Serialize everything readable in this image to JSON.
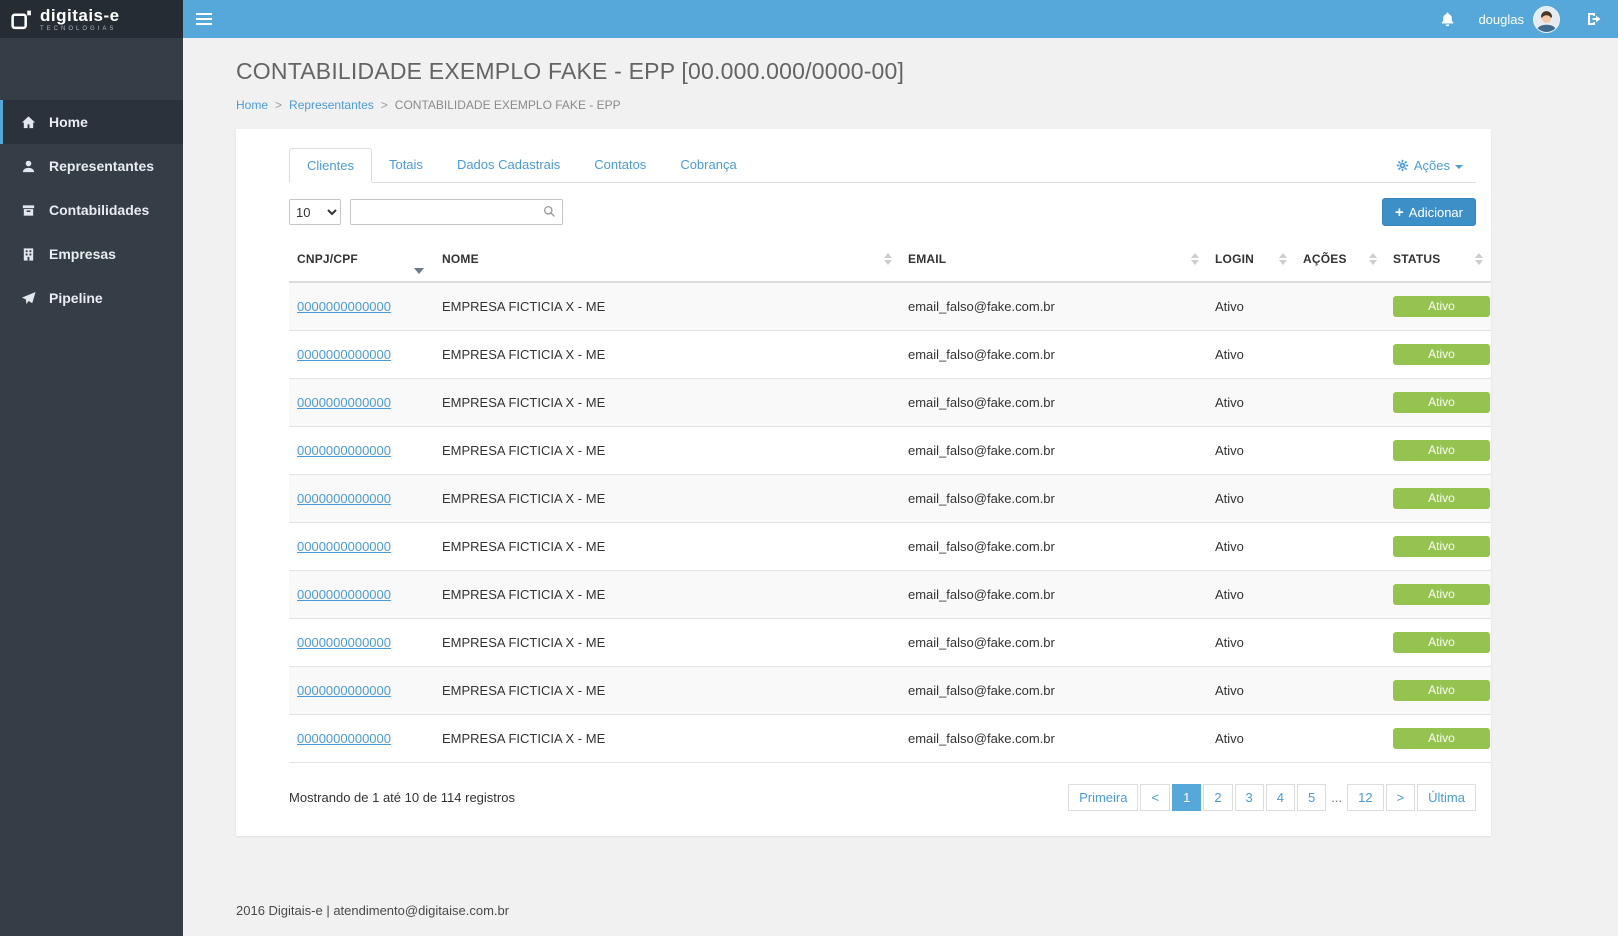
{
  "brand": {
    "logo_text": "digitais-e",
    "logo_sub": "TECNOLOGIAS"
  },
  "topbar": {
    "username": "douglas"
  },
  "sidebar": {
    "items": [
      {
        "label": "Home",
        "icon": "home-icon",
        "active": true
      },
      {
        "label": "Representantes",
        "icon": "user-icon",
        "active": false
      },
      {
        "label": "Contabilidades",
        "icon": "archive-icon",
        "active": false
      },
      {
        "label": "Empresas",
        "icon": "building-icon",
        "active": false
      },
      {
        "label": "Pipeline",
        "icon": "plane-icon",
        "active": false
      }
    ]
  },
  "page": {
    "title": "CONTABILIDADE EXEMPLO FAKE - EPP [00.000.000/0000-00]",
    "breadcrumb": [
      "Home",
      "Representantes",
      "CONTABILIDADE EXEMPLO FAKE - EPP"
    ]
  },
  "tabs": {
    "items": [
      {
        "label": "Clientes",
        "active": true
      },
      {
        "label": "Totais",
        "active": false
      },
      {
        "label": "Dados Cadastrais",
        "active": false
      },
      {
        "label": "Contatos",
        "active": false
      },
      {
        "label": "Cobrança",
        "active": false
      }
    ],
    "actions_label": "Ações"
  },
  "toolbar": {
    "page_size": "10",
    "search_value": "",
    "add_label": "Adicionar"
  },
  "table": {
    "headers": [
      "CNPJ/CPF",
      "NOME",
      "EMAIL",
      "LOGIN",
      "AÇÕES",
      "STATUS"
    ],
    "sorted_column": "CNPJ/CPF",
    "sort_direction": "desc",
    "rows": [
      {
        "cnpj": "0000000000000",
        "nome": "EMPRESA FICTICIA X - ME",
        "email": "email_falso@fake.com.br",
        "login": "Ativo",
        "acoes": "",
        "status": "Ativo"
      },
      {
        "cnpj": "0000000000000",
        "nome": "EMPRESA FICTICIA X - ME",
        "email": "email_falso@fake.com.br",
        "login": "Ativo",
        "acoes": "",
        "status": "Ativo"
      },
      {
        "cnpj": "0000000000000",
        "nome": "EMPRESA FICTICIA X - ME",
        "email": "email_falso@fake.com.br",
        "login": "Ativo",
        "acoes": "",
        "status": "Ativo"
      },
      {
        "cnpj": "0000000000000",
        "nome": "EMPRESA FICTICIA X - ME",
        "email": "email_falso@fake.com.br",
        "login": "Ativo",
        "acoes": "",
        "status": "Ativo"
      },
      {
        "cnpj": "0000000000000",
        "nome": "EMPRESA FICTICIA X - ME",
        "email": "email_falso@fake.com.br",
        "login": "Ativo",
        "acoes": "",
        "status": "Ativo"
      },
      {
        "cnpj": "0000000000000",
        "nome": "EMPRESA FICTICIA X - ME",
        "email": "email_falso@fake.com.br",
        "login": "Ativo",
        "acoes": "",
        "status": "Ativo"
      },
      {
        "cnpj": "0000000000000",
        "nome": "EMPRESA FICTICIA X - ME",
        "email": "email_falso@fake.com.br",
        "login": "Ativo",
        "acoes": "",
        "status": "Ativo"
      },
      {
        "cnpj": "0000000000000",
        "nome": "EMPRESA FICTICIA X - ME",
        "email": "email_falso@fake.com.br",
        "login": "Ativo",
        "acoes": "",
        "status": "Ativo"
      },
      {
        "cnpj": "0000000000000",
        "nome": "EMPRESA FICTICIA X - ME",
        "email": "email_falso@fake.com.br",
        "login": "Ativo",
        "acoes": "",
        "status": "Ativo"
      },
      {
        "cnpj": "0000000000000",
        "nome": "EMPRESA FICTICIA X - ME",
        "email": "email_falso@fake.com.br",
        "login": "Ativo",
        "acoes": "",
        "status": "Ativo"
      }
    ]
  },
  "pagination": {
    "info": "Mostrando de 1 até 10 de 114 registros",
    "items": [
      {
        "label": "Primeira",
        "name": "first",
        "type": "button",
        "active": false
      },
      {
        "label": "<",
        "name": "prev",
        "type": "button",
        "active": false
      },
      {
        "label": "1",
        "name": "1",
        "type": "button",
        "active": true
      },
      {
        "label": "2",
        "name": "2",
        "type": "button",
        "active": false
      },
      {
        "label": "3",
        "name": "3",
        "type": "button",
        "active": false
      },
      {
        "label": "4",
        "name": "4",
        "type": "button",
        "active": false
      },
      {
        "label": "5",
        "name": "5",
        "type": "button",
        "active": false
      },
      {
        "label": "...",
        "name": "ellipsis",
        "type": "ellipsis",
        "active": false
      },
      {
        "label": "12",
        "name": "12",
        "type": "button",
        "active": false
      },
      {
        "label": ">",
        "name": "next",
        "type": "button",
        "active": false
      },
      {
        "label": "Última",
        "name": "last",
        "type": "button",
        "active": false
      }
    ]
  },
  "footer": {
    "text": "2016 Digitais-e | atendimento@digitaise.com.br"
  },
  "colors": {
    "topbar_blue": "#55a8d9",
    "sidebar_dark": "#353d47",
    "link_blue": "#4b9cd6",
    "add_button_blue": "#3d8fc7",
    "status_green": "#94c34f",
    "login_green": "#79a83b"
  }
}
